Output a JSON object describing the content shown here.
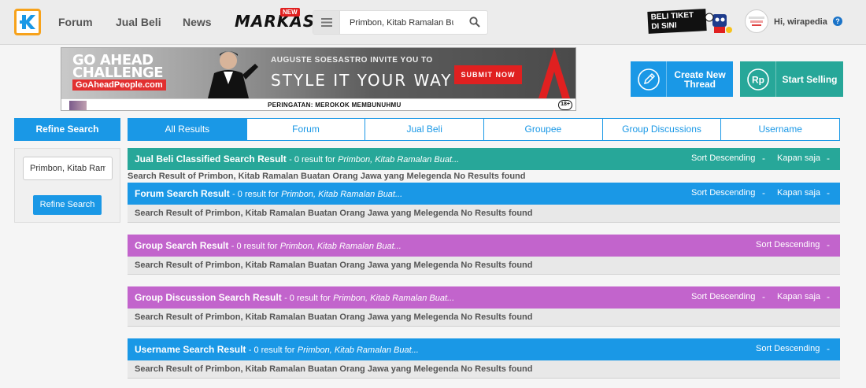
{
  "header": {
    "nav": [
      "Forum",
      "Jual Beli",
      "News"
    ],
    "markas_label": "MARKAS",
    "markas_badge": "NEW",
    "search_value": "Primbon, Kitab Ramalan Bu",
    "beli_tiket_label": "BELI TIKET DI SINI",
    "user_greeting": "Hi, wirapedia",
    "help_label": "?"
  },
  "banner": {
    "title_line1": "GO AHEAD",
    "title_line2": "CHALLENGE",
    "url": "GoAheadPeople.com",
    "invite": "AUGUSTE SOESASTRO INVITE YOU TO",
    "headline": "STYLE IT YOUR WAY",
    "submit": "SUBMIT NOW",
    "warning": "PERINGATAN: MEROKOK MEMBUNUHMU",
    "age": "18+"
  },
  "actions": {
    "create_thread": "Create New Thread",
    "start_selling": "Start Selling"
  },
  "sidebar": {
    "heading": "Refine Search",
    "input_value": "Primbon, Kitab Ramalan",
    "button": "Refine Search"
  },
  "tabs": [
    "All Results",
    "Forum",
    "Jual Beli",
    "Groupee",
    "Group Discussions",
    "Username"
  ],
  "results": {
    "sort_label": "Sort Descending",
    "time_label": "Kapan saja",
    "dash": "-",
    "query_short": "Primbon, Kitab Ramalan Buat...",
    "count_text": "- 0 result for",
    "no_result_msg": "Search Result of Primbon, Kitab Ramalan Buatan Orang Jawa yang Melegenda No Results found",
    "sections": [
      {
        "title": "Jual Beli Classified Search Result"
      },
      {
        "title": "Forum Search Result"
      },
      {
        "title": "Group Search Result"
      },
      {
        "title": "Group Discussion Search Result"
      },
      {
        "title": "Username Search Result"
      }
    ]
  },
  "colors": {
    "blue": "#1a98e6",
    "teal": "#27a799",
    "purple": "#c264cc",
    "orange_logo": "#f7a21b"
  }
}
